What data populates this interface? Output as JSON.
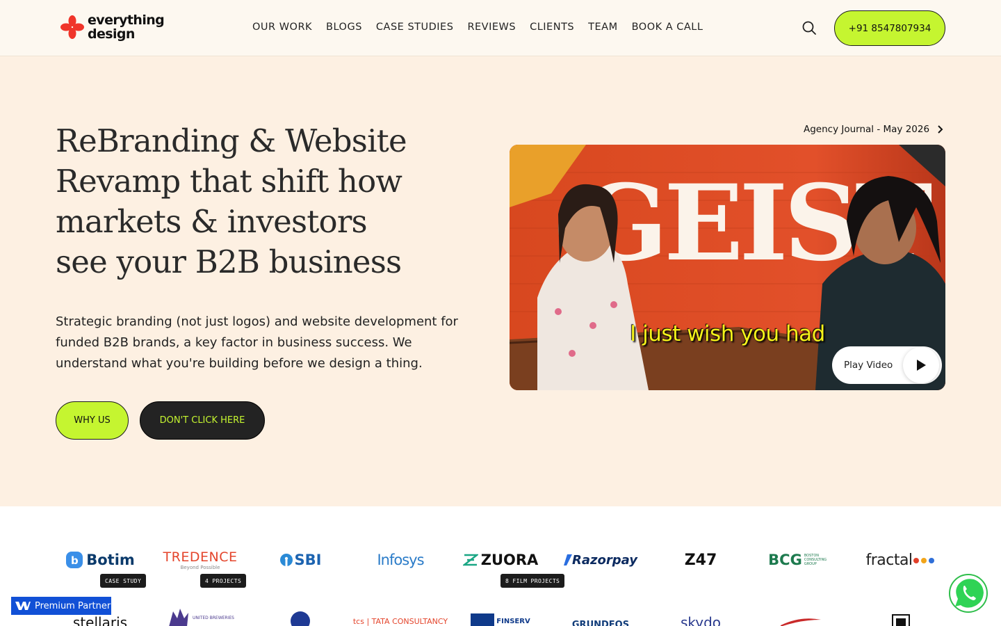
{
  "header": {
    "logo_line1": "everything",
    "logo_line2": "design",
    "nav": [
      "OUR WORK",
      "BLOGS",
      "CASE STUDIES",
      "REVIEWS",
      "CLIENTS",
      "TEAM",
      "BOOK A CALL"
    ],
    "phone": "+91 8547807934"
  },
  "hero": {
    "title_lines": [
      "ReBranding & Website",
      "Revamp that shift how",
      "markets & investors",
      "see your B2B business"
    ],
    "subtitle": "Strategic branding (not just logos) and website development for funded B2B brands, a key factor in business success. We understand what you're building before we design a thing.",
    "btn_primary": "WHY US",
    "btn_secondary": "DON'T CLICK HERE",
    "journal": "Agency Journal - May 2026",
    "video_caption": "I just wish you had",
    "video_wall_text": "GEIST",
    "play_label": "Play Video"
  },
  "clients": {
    "row1": [
      {
        "name": "Botim",
        "color": "#0b3a6b"
      },
      {
        "name": "TREDENCE",
        "sub": "Beyond Possible",
        "color": "#e4452c"
      },
      {
        "name": "SBI",
        "color": "#1c63b0"
      },
      {
        "name": "Infosys",
        "color": "#2a7bc8"
      },
      {
        "name": "ZUORA",
        "color": "#111111"
      },
      {
        "name": "Razorpay",
        "color": "#0b2a60"
      },
      {
        "name": "Z47",
        "color": "#111111"
      },
      {
        "name": "BCG",
        "sub": "BOSTON CONSULTING GROUP",
        "color": "#1d7a4e"
      },
      {
        "name": "fractal",
        "color": "#222222"
      }
    ],
    "row2": [
      {
        "name": "stellaris",
        "color": "#111111"
      },
      {
        "name": "UNITED BREWERIES",
        "color": "#4b3a8e"
      },
      {
        "name": "Jio",
        "color": "#1f3a94"
      },
      {
        "name": "tcs | TATA CONSULTANCY",
        "color": "#e4452c"
      },
      {
        "name": "FINSERV",
        "color": "#0f3a8a"
      },
      {
        "name": "GRUNDFOS",
        "color": "#123d7a"
      },
      {
        "name": "skydo",
        "color": "#2a3a8e"
      },
      {
        "name": "",
        "color": "#c92a2a"
      },
      {
        "name": "",
        "color": "#111111"
      }
    ],
    "tags": [
      "CASE STUDY",
      "4 PROJECTS",
      "8 FILM PROJECTS"
    ]
  },
  "badge": {
    "partner": "Premium Partner"
  },
  "colors": {
    "accent": "#c5f530",
    "bg_hero": "#fdf0e2",
    "dark": "#232323"
  }
}
